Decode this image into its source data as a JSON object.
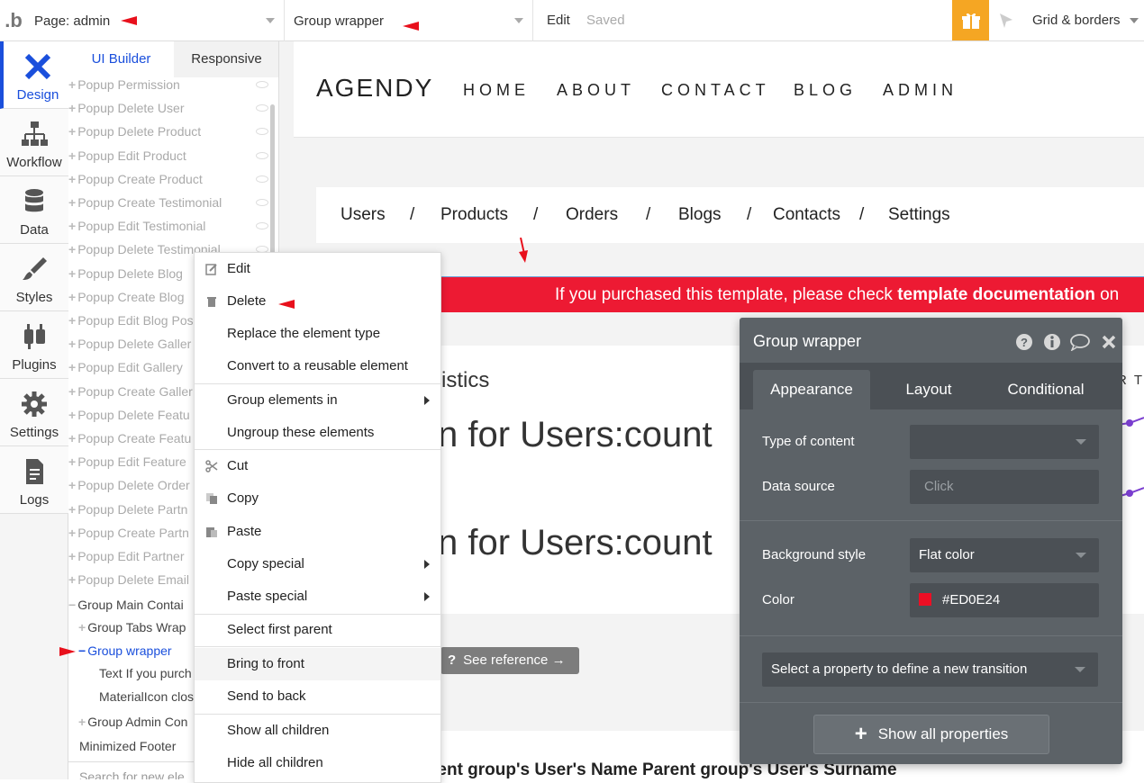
{
  "topbar": {
    "logo": ".b",
    "page_label": "Page: admin",
    "element_label": "Group wrapper",
    "edit_label": "Edit",
    "saved_label": "Saved",
    "grid_label": "Grid & borders"
  },
  "lefttabs": [
    {
      "label": "Design",
      "icon": "design-icon"
    },
    {
      "label": "Workflow",
      "icon": "workflow-icon"
    },
    {
      "label": "Data",
      "icon": "data-icon"
    },
    {
      "label": "Styles",
      "icon": "styles-icon"
    },
    {
      "label": "Plugins",
      "icon": "plugins-icon"
    },
    {
      "label": "Settings",
      "icon": "gear-icon"
    },
    {
      "label": "Logs",
      "icon": "logs-icon"
    }
  ],
  "tree": {
    "tab_builder": "UI Builder",
    "tab_responsive": "Responsive",
    "items": [
      "Popup Permission",
      "Popup Delete User",
      "Popup Delete Product",
      "Popup Edit Product",
      "Popup Create Product",
      "Popup Create Testimonial",
      "Popup Edit Testimonial",
      "Popup Delete Testimonial",
      "Popup Delete Blog",
      "Popup Create Blog",
      "Popup Edit Blog Pos",
      "Popup Delete Galler",
      "Popup Edit Gallery",
      "Popup Create Galler",
      "Popup Delete Featu",
      "Popup Create Featu",
      "Popup Edit Feature",
      "Popup Delete Order",
      "Popup Delete Partn",
      "Popup Create Partn",
      "Popup Edit Partner",
      "Popup Delete Email"
    ],
    "group_main": "Group Main Contai",
    "group_tabs": "Group Tabs Wrap",
    "group_wrapper": "Group wrapper",
    "text_child": "Text If you purch",
    "icon_child": "MaterialIcon clos",
    "group_admin": "Group Admin Con",
    "min_footer": "Minimized Footer",
    "search_placeholder": "Search for new ele"
  },
  "canvas": {
    "brand": "AGENDY",
    "nav": [
      "HOME",
      "ABOUT",
      "CONTACT",
      "BLOG",
      "ADMIN"
    ],
    "crumbs": [
      "Users",
      "Products",
      "Orders",
      "Blogs",
      "Contacts",
      "Settings"
    ],
    "crumb_sep": "/",
    "banner_prefix": "If you purchased this template, please check ",
    "banner_bold": "template documentation",
    "banner_suffix": " on",
    "stats_title": "istics",
    "big_line_1": "n for Users:count",
    "big_line_2": "n for Users:count",
    "see_reference": "See reference →",
    "bottom_text": "rent group's User's Name Parent group's User's Surname",
    "edge_letters": "R  T"
  },
  "context_menu": {
    "items": [
      "Edit",
      "Delete",
      "Replace the element type",
      "Convert to a reusable element",
      "Group elements in",
      "Ungroup these elements",
      "Cut",
      "Copy",
      "Paste",
      "Copy special",
      "Paste special",
      "Select first parent",
      "Bring to front",
      "Send to back",
      "Show all children",
      "Hide all children"
    ]
  },
  "panel": {
    "title": "Group wrapper",
    "tabs": [
      "Appearance",
      "Layout",
      "Conditional"
    ],
    "type_of_content_label": "Type of content",
    "type_of_content_value": "",
    "data_source_label": "Data source",
    "data_source_placeholder": "Click",
    "bg_style_label": "Background style",
    "bg_style_value": "Flat color",
    "color_label": "Color",
    "color_value": "#ED0E24",
    "transition_label": "Select a property to define a new transition",
    "show_all": "Show all properties"
  },
  "colors": {
    "accent": "#1a4fdc",
    "banner": "#ed1a33",
    "panel_bg": "#5c6267",
    "gift": "#f5a623",
    "swatch": "#ED0E24"
  }
}
